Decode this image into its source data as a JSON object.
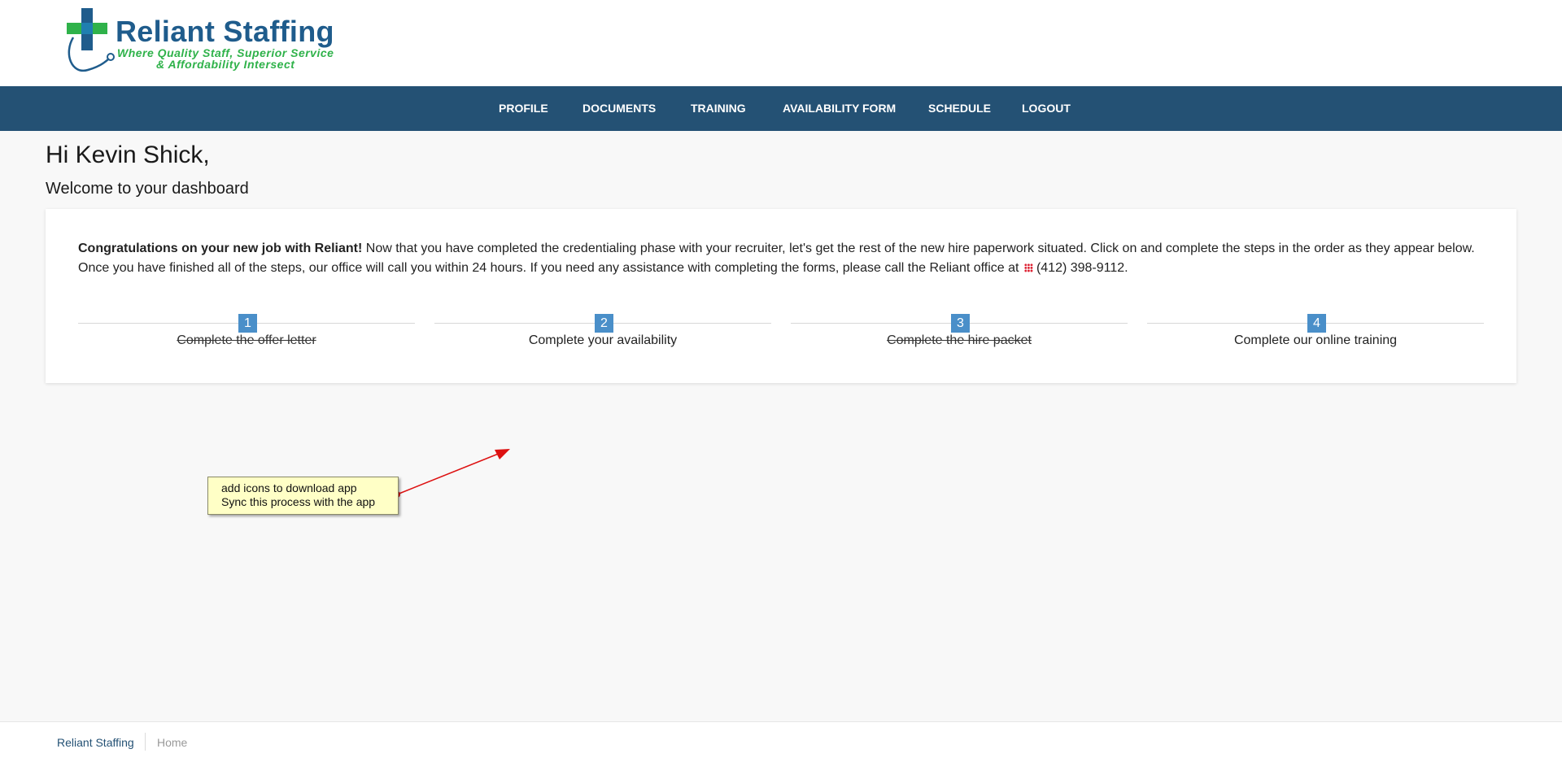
{
  "brand": {
    "name": "Reliant Staffing",
    "tagline_line1": "Where Quality Staff, Superior Service",
    "tagline_line2": "& Affordability Intersect"
  },
  "nav": {
    "items": [
      "PROFILE",
      "DOCUMENTS",
      "TRAINING",
      "AVAILABILITY FORM",
      "SCHEDULE",
      "LOGOUT"
    ]
  },
  "greeting": "Hi Kevin Shick,",
  "subgreeting": "Welcome to your dashboard",
  "intro": {
    "bold": "Congratulations on your new job with Reliant!",
    "text": " Now that you have completed the credentialing phase with your recruiter, let's get the rest of the new hire paperwork situated. Click on and complete the steps in the order as they appear below. Once you have finished all of the steps, our office will call you within 24 hours. If you need any assistance with completing the forms, please call the Reliant office at",
    "phone": "(412) 398-9112."
  },
  "steps": [
    {
      "num": "1",
      "label": "Complete the offer letter",
      "done": true
    },
    {
      "num": "2",
      "label": "Complete your availability",
      "done": false
    },
    {
      "num": "3",
      "label": "Complete the hire packet",
      "done": true
    },
    {
      "num": "4",
      "label": "Complete our online training",
      "done": false
    }
  ],
  "annotation": {
    "line1": "add icons to download app",
    "line2": "Sync this process with the app"
  },
  "footer": {
    "home": "Reliant Staffing",
    "current": "Home"
  },
  "colors": {
    "nav_bg": "#245174",
    "step_badge": "#4a8fc9",
    "brand_blue": "#1f5c8c",
    "brand_green": "#2fb24a"
  }
}
